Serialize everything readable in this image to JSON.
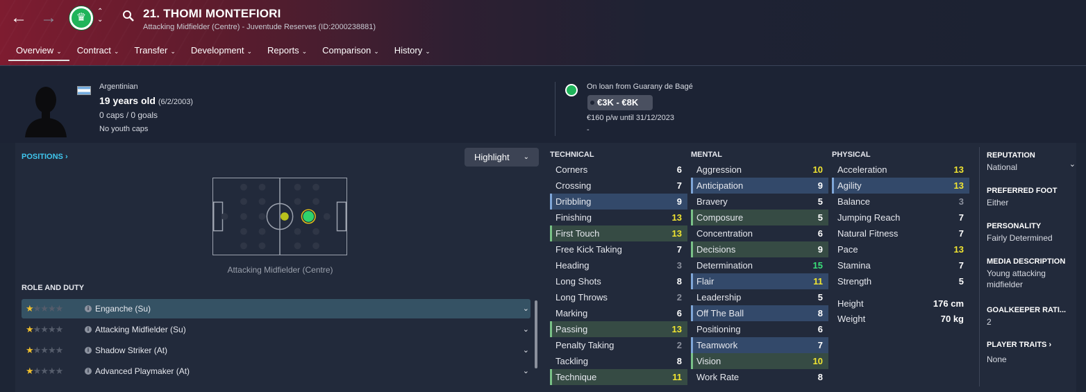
{
  "header": {
    "player_title": "21. THOMI MONTEFIORI",
    "subtitle": "Attacking Midfielder (Centre) - Juventude Reserves (ID:2000238881)",
    "back_icon": "arrow-left-icon",
    "forward_icon": "arrow-right-icon",
    "tabs": [
      {
        "label": "Overview"
      },
      {
        "label": "Contract"
      },
      {
        "label": "Transfer"
      },
      {
        "label": "Development"
      },
      {
        "label": "Reports"
      },
      {
        "label": "Comparison"
      },
      {
        "label": "History"
      }
    ]
  },
  "summary": {
    "nationality": "Argentinian",
    "age": "19 years old",
    "dob": "(6/2/2003)",
    "caps": "0 caps / 0 goals",
    "youth_caps": "No youth caps",
    "loan_text": "On loan from Guarany de Bagé",
    "value": "€3K - €8K",
    "wage": "€160 p/w until 31/12/2023",
    "extra": "-"
  },
  "positions": {
    "title": "POSITIONS",
    "highlight_label": "Highlight",
    "caption": "Attacking Midfielder (Centre)"
  },
  "roles": {
    "title": "ROLE AND DUTY",
    "items": [
      {
        "name": "Enganche (Su)",
        "stars": 1
      },
      {
        "name": "Attacking Midfielder (Su)",
        "stars": 1
      },
      {
        "name": "Shadow Striker (At)",
        "stars": 1
      },
      {
        "name": "Advanced Playmaker (At)",
        "stars": 1
      }
    ]
  },
  "technical": {
    "title": "TECHNICAL",
    "rows": [
      {
        "label": "Corners",
        "value": "6"
      },
      {
        "label": "Crossing",
        "value": "7"
      },
      {
        "label": "Dribbling",
        "value": "9"
      },
      {
        "label": "Finishing",
        "value": "13"
      },
      {
        "label": "First Touch",
        "value": "13"
      },
      {
        "label": "Free Kick Taking",
        "value": "7"
      },
      {
        "label": "Heading",
        "value": "3"
      },
      {
        "label": "Long Shots",
        "value": "8"
      },
      {
        "label": "Long Throws",
        "value": "2"
      },
      {
        "label": "Marking",
        "value": "6"
      },
      {
        "label": "Passing",
        "value": "13"
      },
      {
        "label": "Penalty Taking",
        "value": "2"
      },
      {
        "label": "Tackling",
        "value": "8"
      },
      {
        "label": "Technique",
        "value": "11"
      }
    ]
  },
  "mental": {
    "title": "MENTAL",
    "rows": [
      {
        "label": "Aggression",
        "value": "10"
      },
      {
        "label": "Anticipation",
        "value": "9"
      },
      {
        "label": "Bravery",
        "value": "5"
      },
      {
        "label": "Composure",
        "value": "5"
      },
      {
        "label": "Concentration",
        "value": "6"
      },
      {
        "label": "Decisions",
        "value": "9"
      },
      {
        "label": "Determination",
        "value": "15"
      },
      {
        "label": "Flair",
        "value": "11"
      },
      {
        "label": "Leadership",
        "value": "5"
      },
      {
        "label": "Off The Ball",
        "value": "8"
      },
      {
        "label": "Positioning",
        "value": "6"
      },
      {
        "label": "Teamwork",
        "value": "7"
      },
      {
        "label": "Vision",
        "value": "10"
      },
      {
        "label": "Work Rate",
        "value": "8"
      }
    ]
  },
  "physical": {
    "title": "PHYSICAL",
    "rows": [
      {
        "label": "Acceleration",
        "value": "13"
      },
      {
        "label": "Agility",
        "value": "13"
      },
      {
        "label": "Balance",
        "value": "3"
      },
      {
        "label": "Jumping Reach",
        "value": "7"
      },
      {
        "label": "Natural Fitness",
        "value": "7"
      },
      {
        "label": "Pace",
        "value": "13"
      },
      {
        "label": "Stamina",
        "value": "7"
      },
      {
        "label": "Strength",
        "value": "5"
      }
    ],
    "height_label": "Height",
    "height_value": "176 cm",
    "weight_label": "Weight",
    "weight_value": "70 kg"
  },
  "info": {
    "reputation_title": "REPUTATION",
    "reputation_value": "National",
    "foot_title": "PREFERRED FOOT",
    "foot_value": "Either",
    "personality_title": "PERSONALITY",
    "personality_value": "Fairly Determined",
    "media_title": "MEDIA DESCRIPTION",
    "media_value": "Young attacking midfielder",
    "gk_title": "GOALKEEPER RATI...",
    "gk_value": "2",
    "traits_title": "PLAYER TRAITS",
    "traits_value": "None"
  },
  "colors": {
    "accent": "#3fc6ee",
    "attr_high": "#f1e531",
    "attr_top": "#3ae079",
    "attr_low": "#8a8f9c",
    "badge_green": "#1fb45a"
  }
}
